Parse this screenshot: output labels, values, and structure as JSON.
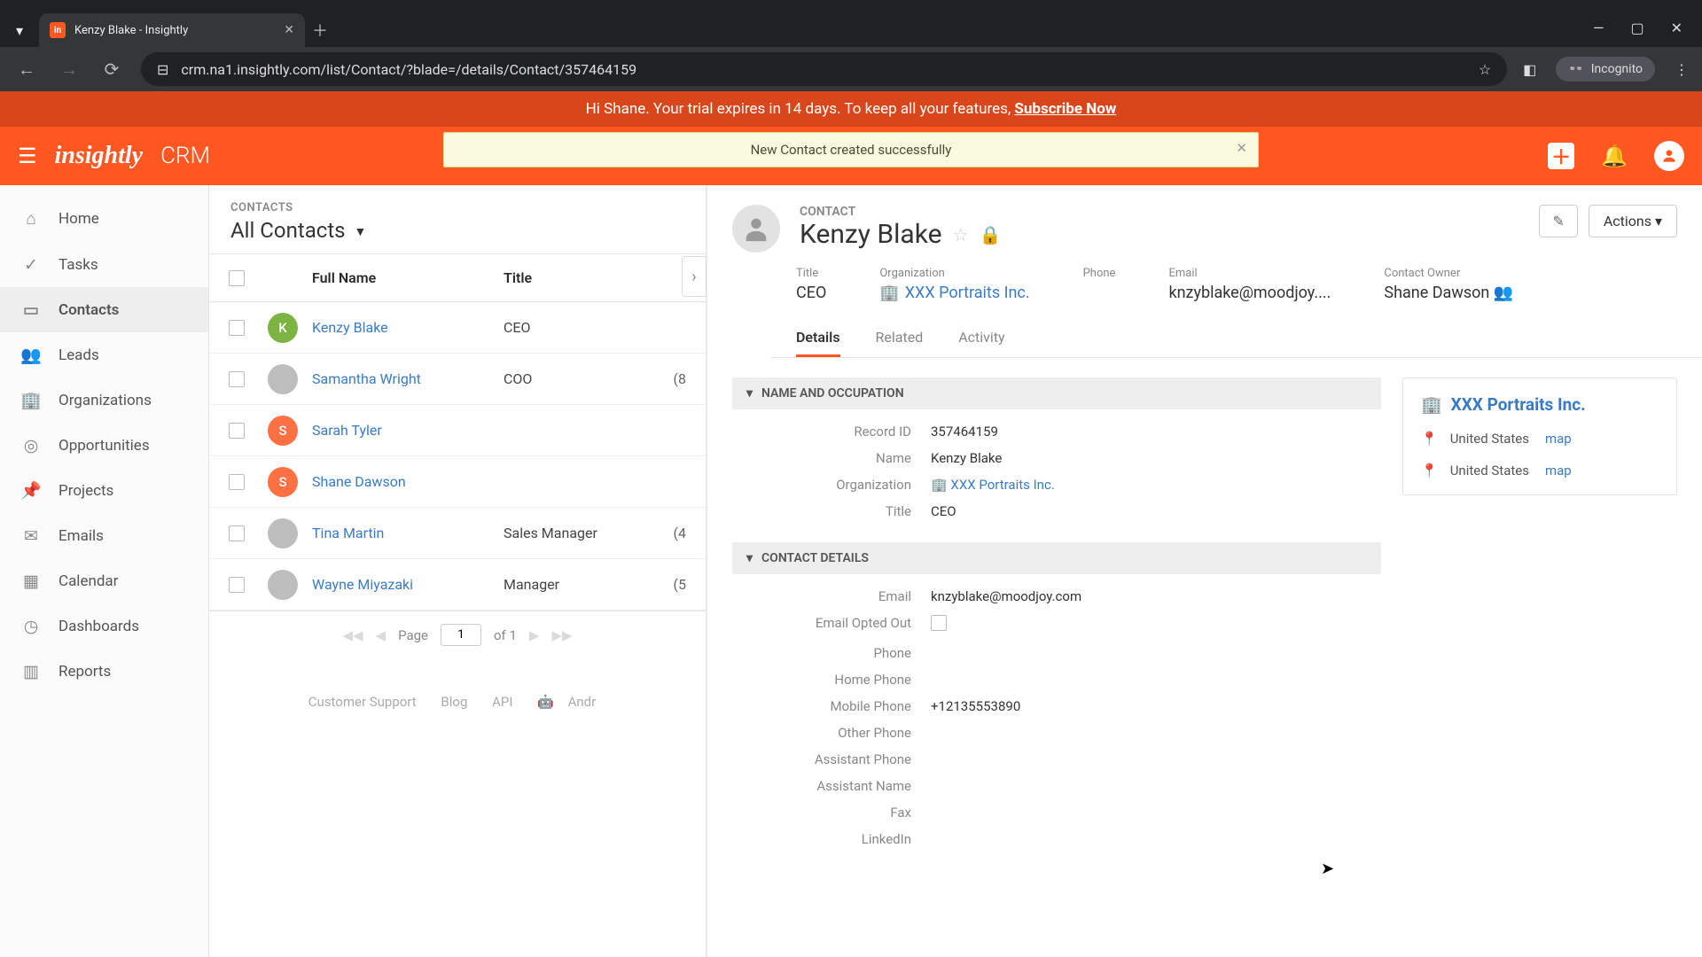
{
  "browser": {
    "tab_title": "Kenzy Blake - Insightly",
    "url": "crm.na1.insightly.com/list/Contact/?blade=/details/Contact/357464159",
    "incognito": "Incognito"
  },
  "trial": {
    "text": "Hi Shane. Your trial expires in 14 days. To keep all your features, ",
    "cta": "Subscribe Now"
  },
  "topbar": {
    "brand": "insightly",
    "sub": "CRM",
    "toast": "New Contact created successfully"
  },
  "sidebar": {
    "items": [
      {
        "label": "Home",
        "icon": "⌂"
      },
      {
        "label": "Tasks",
        "icon": "✓"
      },
      {
        "label": "Contacts",
        "icon": "▭"
      },
      {
        "label": "Leads",
        "icon": "👥"
      },
      {
        "label": "Organizations",
        "icon": "🏢"
      },
      {
        "label": "Opportunities",
        "icon": "◎"
      },
      {
        "label": "Projects",
        "icon": "📌"
      },
      {
        "label": "Emails",
        "icon": "✉"
      },
      {
        "label": "Calendar",
        "icon": "▦"
      },
      {
        "label": "Dashboards",
        "icon": "◷"
      },
      {
        "label": "Reports",
        "icon": "▥"
      }
    ]
  },
  "list": {
    "label": "CONTACTS",
    "view": "All Contacts",
    "cols": {
      "name": "Full Name",
      "title": "Title"
    },
    "rows": [
      {
        "initial": "K",
        "color": "#7cb342",
        "name": "Kenzy Blake",
        "title": "CEO"
      },
      {
        "initial": "",
        "color": "#bdbdbd",
        "name": "Samantha Wright",
        "title": "COO",
        "extra": "(8"
      },
      {
        "initial": "S",
        "color": "#ff7043",
        "name": "Sarah Tyler",
        "title": ""
      },
      {
        "initial": "S",
        "color": "#ff7043",
        "name": "Shane Dawson",
        "title": ""
      },
      {
        "initial": "",
        "color": "#bdbdbd",
        "name": "Tina Martin",
        "title": "Sales Manager",
        "extra": "(4"
      },
      {
        "initial": "",
        "color": "#bdbdbd",
        "name": "Wayne Miyazaki",
        "title": "Manager",
        "extra": "(5"
      }
    ],
    "pager": {
      "page_label": "Page",
      "page": "1",
      "of": "of 1"
    },
    "footer": {
      "cs": "Customer Support",
      "blog": "Blog",
      "api": "API",
      "android": "Andr"
    }
  },
  "detail": {
    "type": "CONTACT",
    "name": "Kenzy Blake",
    "actions": "Actions",
    "summary": {
      "title_l": "Title",
      "title": "CEO",
      "org_l": "Organization",
      "org": "XXX Portraits Inc.",
      "phone_l": "Phone",
      "phone": "",
      "email_l": "Email",
      "email": "knzyblake@moodjoy....",
      "owner_l": "Contact Owner",
      "owner": "Shane Dawson"
    },
    "tabs": {
      "details": "Details",
      "related": "Related",
      "activity": "Activity"
    },
    "sections": {
      "name": "NAME AND OCCUPATION",
      "contact": "CONTACT DETAILS"
    },
    "fields": {
      "record_id_l": "Record ID",
      "record_id": "357464159",
      "name_l": "Name",
      "name": "Kenzy Blake",
      "org_l": "Organization",
      "org": "XXX Portraits Inc.",
      "title_l": "Title",
      "title": "CEO",
      "email_l": "Email",
      "email": "knzyblake@moodjoy.com",
      "opt_l": "Email Opted Out",
      "phone_l": "Phone",
      "home_l": "Home Phone",
      "mobile_l": "Mobile Phone",
      "mobile": "+12135553890",
      "other_l": "Other Phone",
      "asst_l": "Assistant Phone",
      "asstn_l": "Assistant Name",
      "fax_l": "Fax",
      "linkedin_l": "LinkedIn"
    },
    "side": {
      "org": "XXX Portraits Inc.",
      "loc1": "United States",
      "map": "map",
      "loc2": "United States"
    }
  }
}
